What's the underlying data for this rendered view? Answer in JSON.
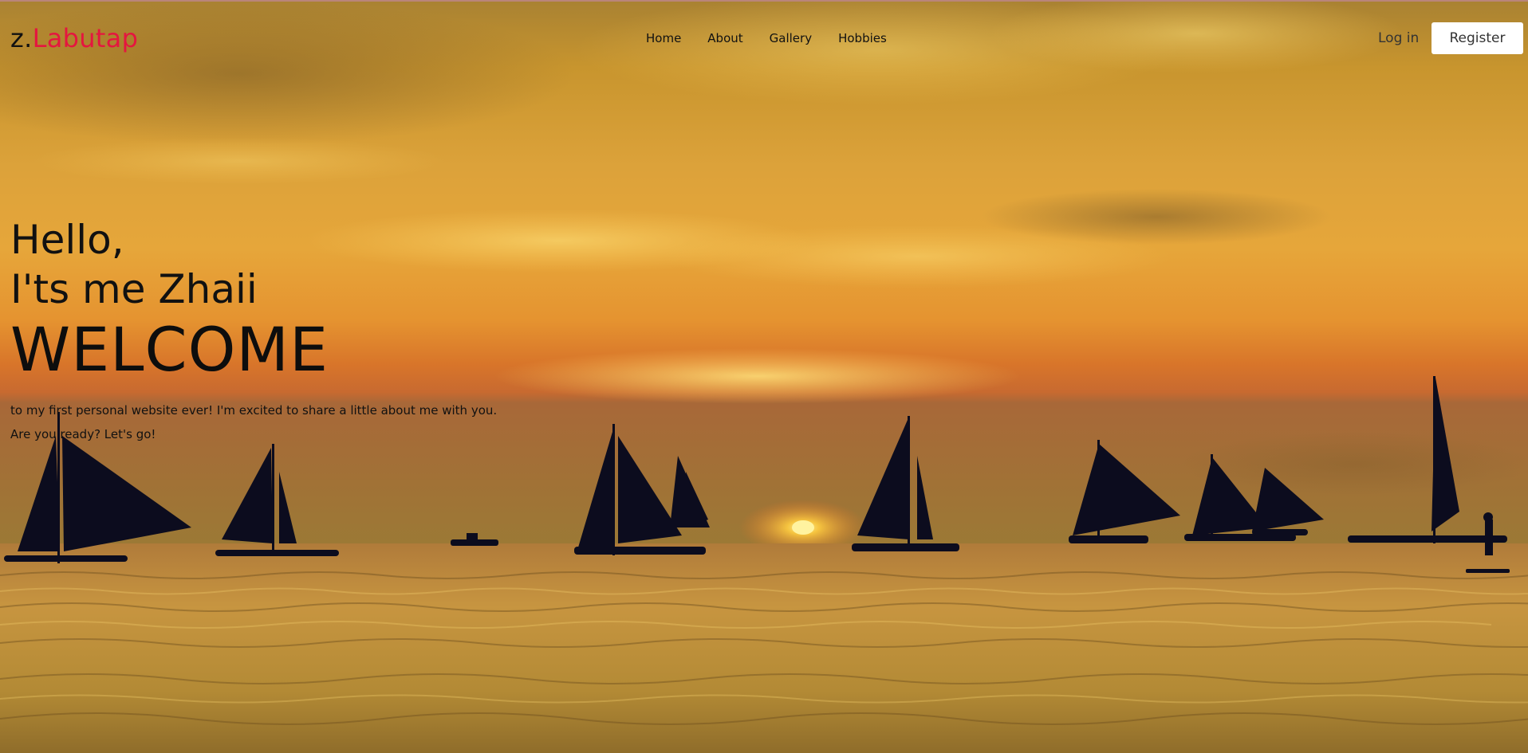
{
  "header": {
    "logo_prefix": "z.",
    "logo_name": "Labutap",
    "nav": [
      {
        "label": "Home"
      },
      {
        "label": "About"
      },
      {
        "label": "Gallery"
      },
      {
        "label": "Hobbies"
      }
    ],
    "login_label": "Log in",
    "register_label": "Register"
  },
  "hero": {
    "greeting": "Hello,",
    "intro_name": "I'ts me Zhaii",
    "headline": "WELCOME",
    "line1": "to my first personal website ever! I'm excited to share a little about me with you.",
    "line2": "Are you ready? Let's go!"
  },
  "colors": {
    "brand_accent": "#e5163f",
    "text": "#111111",
    "register_bg": "#ffffff"
  }
}
